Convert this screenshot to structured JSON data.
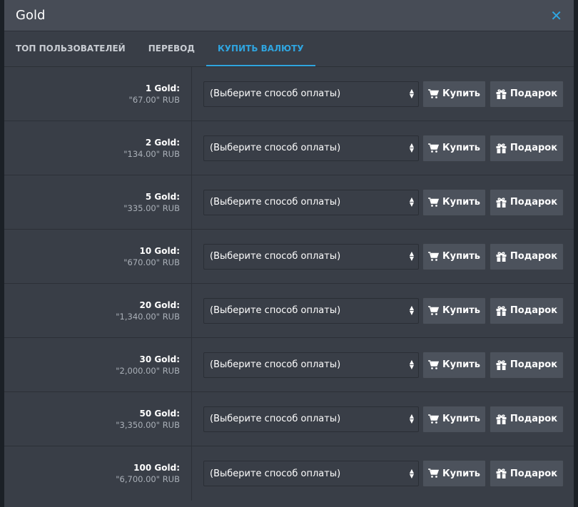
{
  "window": {
    "title": "Gold",
    "close_icon": "close-icon"
  },
  "tabs": [
    {
      "label": "ТОП ПОЛЬЗОВАТЕЛЕЙ",
      "active": false
    },
    {
      "label": "ПЕРЕВОД",
      "active": false
    },
    {
      "label": "КУПИТЬ ВАЛЮТУ",
      "active": true
    }
  ],
  "colors": {
    "accent": "#2fa5e0",
    "panel": "#393e47",
    "header": "#474c56",
    "button": "#4c525c"
  },
  "buy_label": "Купить",
  "gift_label": "Подарок",
  "payment_select_value": "(Выберите способ оплаты)",
  "icons": {
    "buy": "cart-icon",
    "gift": "gift-icon",
    "select": "sort-caret-icon"
  },
  "offers": [
    {
      "amount": "1 Gold:",
      "price": "\"67.00\" RUB"
    },
    {
      "amount": "2 Gold:",
      "price": "\"134.00\" RUB"
    },
    {
      "amount": "5 Gold:",
      "price": "\"335.00\" RUB"
    },
    {
      "amount": "10 Gold:",
      "price": "\"670.00\" RUB"
    },
    {
      "amount": "20 Gold:",
      "price": "\"1,340.00\" RUB"
    },
    {
      "amount": "30 Gold:",
      "price": "\"2,000.00\" RUB"
    },
    {
      "amount": "50 Gold:",
      "price": "\"3,350.00\" RUB"
    },
    {
      "amount": "100 Gold:",
      "price": "\"6,700.00\" RUB"
    }
  ]
}
